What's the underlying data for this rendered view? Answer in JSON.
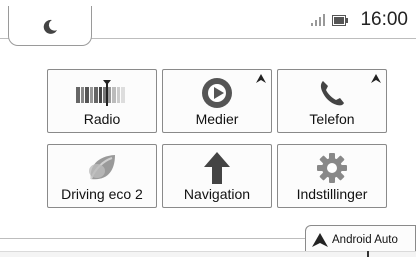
{
  "status_bar": {
    "time": "16:00",
    "night_mode_icon": "moon-icon",
    "signal_icon": "signal-bars-icon",
    "battery_icon": "battery-icon"
  },
  "tiles": [
    {
      "id": "radio",
      "label": "Radio",
      "icon": "radio-tuner-icon",
      "android_auto_badge": false
    },
    {
      "id": "medier",
      "label": "Medier",
      "icon": "media-play-icon",
      "android_auto_badge": true
    },
    {
      "id": "telefon",
      "label": "Telefon",
      "icon": "phone-icon",
      "android_auto_badge": true
    },
    {
      "id": "driving-eco",
      "label": "Driving eco 2",
      "icon": "eco-leaf-icon",
      "android_auto_badge": false
    },
    {
      "id": "navigation",
      "label": "Navigation",
      "icon": "navigation-arrow-icon",
      "android_auto_badge": false
    },
    {
      "id": "indstillinger",
      "label": "Indstillinger",
      "icon": "gear-icon",
      "android_auto_badge": false
    }
  ],
  "android_auto_tab": {
    "label": "Android Auto",
    "icon": "android-auto-icon"
  },
  "colors": {
    "border": "#8a8a8a",
    "icon_dark": "#333333",
    "icon_mid": "#777777"
  }
}
